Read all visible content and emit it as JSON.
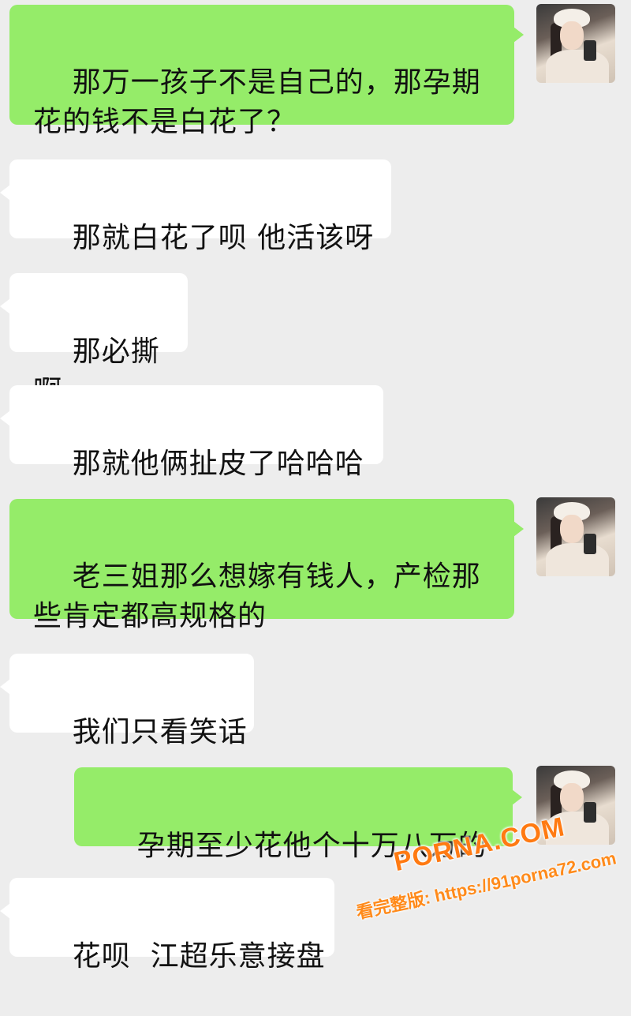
{
  "messages": [
    {
      "side": "out",
      "text": "那万一孩子不是自己的，那孕期\n花的钱不是白花了？"
    },
    {
      "side": "in",
      "text": "那就白花了呗 他活该呀"
    },
    {
      "side": "in",
      "text": "那必撕啊"
    },
    {
      "side": "in",
      "text": "那就他俩扯皮了哈哈哈"
    },
    {
      "side": "out",
      "text": "老三姐那么想嫁有钱人，产检那\n些肯定都高规格的"
    },
    {
      "side": "in",
      "text": "我们只看笑话"
    },
    {
      "side": "out",
      "text": "孕期至少花他个十万八万的"
    },
    {
      "side": "in",
      "text": "花呗  江超乐意接盘"
    }
  ],
  "watermark": {
    "brand": "PORNA.COM",
    "url": "看完整版: https://91porna72.com"
  },
  "colors": {
    "background": "#ededed",
    "outgoing_bubble": "#95ec69",
    "incoming_bubble": "#ffffff",
    "watermark": "#ff7a12"
  },
  "icons": {
    "avatar": "user-avatar-photo"
  }
}
